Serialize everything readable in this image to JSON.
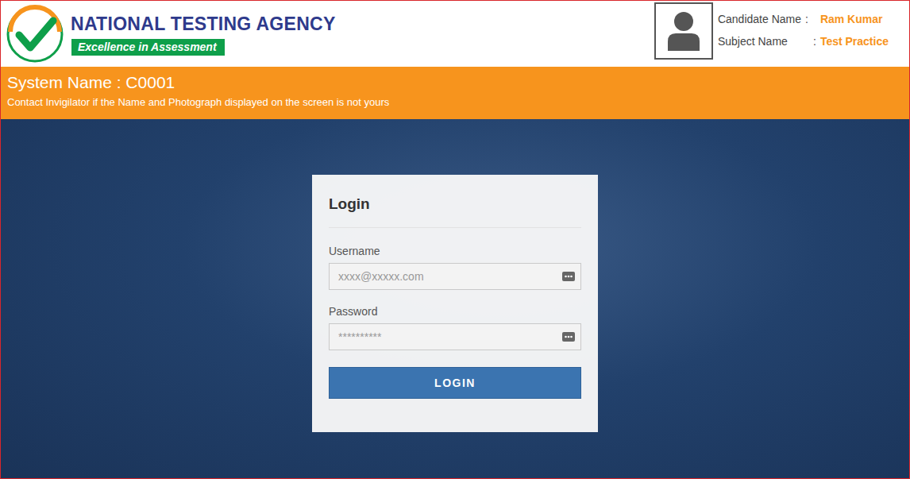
{
  "header": {
    "logo": {
      "title": "NATIONAL TESTING AGENCY",
      "tagline": "Excellence in Assessment"
    },
    "candidate": {
      "fields": [
        {
          "label": "Candidate Name",
          "separator": ":",
          "value": "Ram Kumar"
        },
        {
          "label": "Subject Name",
          "separator": ":",
          "value": "Test Practice"
        }
      ]
    }
  },
  "banner": {
    "system_name": "System Name : C0001",
    "notice": "Contact Invigilator if the Name and Photograph displayed on the screen is not yours"
  },
  "login": {
    "title": "Login",
    "fields": [
      {
        "label": "Username",
        "placeholder": "xxxx@xxxxx.com",
        "kind": "text"
      },
      {
        "label": "Password",
        "placeholder": "**********",
        "kind": "password"
      }
    ],
    "button": "LOGIN"
  }
}
